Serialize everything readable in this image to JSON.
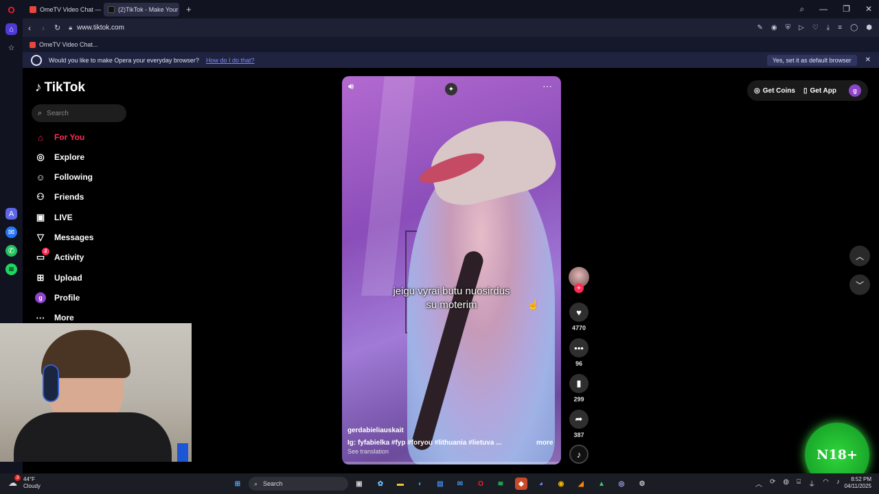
{
  "browser": {
    "tabs": [
      {
        "label": "OmeTV Video Chat — Om",
        "active": false
      },
      {
        "label": "(2)TikTok - Make Your",
        "active": true
      }
    ],
    "url": "www.tiktok.com",
    "bookmark": "OmeTV Video Chat...",
    "promo": {
      "question": "Would you like to make Opera your everyday browser?",
      "link": "How do I do that?",
      "accept": "Yes, set it as default browser"
    }
  },
  "tiktok": {
    "logo": "TikTok",
    "search_placeholder": "Search",
    "nav": [
      {
        "label": "For You",
        "icon": "home-icon",
        "active": true
      },
      {
        "label": "Explore",
        "icon": "compass-icon"
      },
      {
        "label": "Following",
        "icon": "following-icon"
      },
      {
        "label": "Friends",
        "icon": "friends-icon"
      },
      {
        "label": "LIVE",
        "icon": "live-icon"
      },
      {
        "label": "Messages",
        "icon": "messages-icon"
      },
      {
        "label": "Activity",
        "icon": "activity-icon",
        "badge": "2"
      },
      {
        "label": "Upload",
        "icon": "upload-icon"
      },
      {
        "label": "Profile",
        "icon": "profile-icon",
        "avatar_letter": "g"
      },
      {
        "label": "More",
        "icon": "more-icon"
      }
    ],
    "header": {
      "coins": "Get Coins",
      "app": "Get App",
      "avatar_letter": "g"
    },
    "video": {
      "caption_line1": "jeigu vyrai butu nuosirdus",
      "caption_line2": "su moterim",
      "author": "gerdabieliauskait",
      "description": "Ig: fyfabielka #fyp #foryou #lithuania #lietuva ...",
      "more": "more",
      "translation": "See translation"
    },
    "actions": {
      "likes": "4770",
      "comments": "96",
      "saves": "299",
      "shares": "387"
    }
  },
  "overlay_logo": "N18+",
  "taskbar": {
    "weather_temp": "44°F",
    "weather_desc": "Cloudy",
    "weather_badge": "3",
    "search": "Search",
    "time": "8:52 PM",
    "date": "04/11/2025"
  },
  "colors": {
    "accent": "#fe2c55",
    "chrome": "#121321",
    "overlay": "#37d640"
  }
}
